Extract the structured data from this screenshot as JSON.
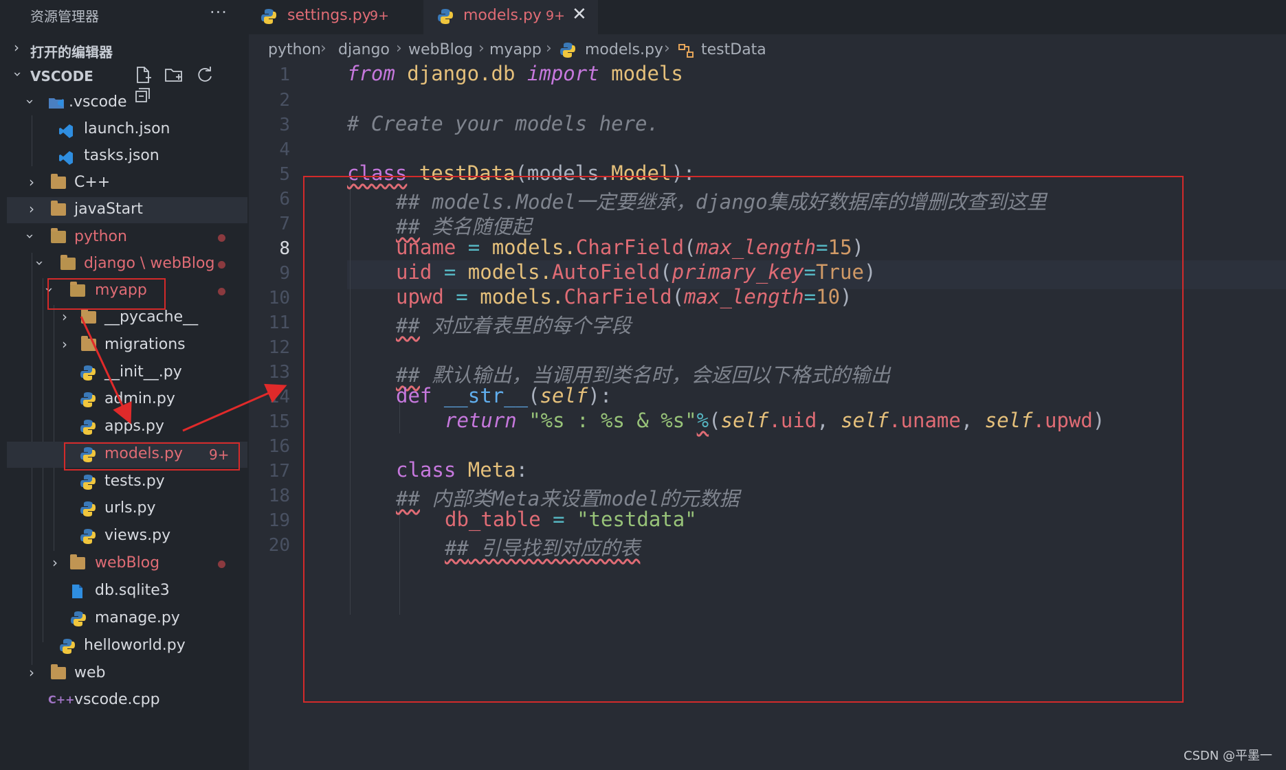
{
  "sidebar": {
    "explorer_title": "资源管理器",
    "more_label": "···",
    "open_editors_label": "打开的编辑器",
    "workspace_label": "VSCODE",
    "tree": {
      "vscode_folder": ".vscode",
      "launch": "launch.json",
      "tasks": "tasks.json",
      "cpp": "C++",
      "javastart": "javaStart",
      "python": "python",
      "django_webblog": "django \\ webBlog",
      "myapp": "myapp",
      "pycache": "__pycache__",
      "migrations": "migrations",
      "init": "__init__.py",
      "admin": "admin.py",
      "apps": "apps.py",
      "models": "models.py",
      "models_badge": "9+",
      "tests": "tests.py",
      "urls": "urls.py",
      "views": "views.py",
      "webblog": "webBlog",
      "db": "db.sqlite3",
      "manage": "manage.py",
      "helloworld": "helloworld.py",
      "web": "web",
      "vscode_cpp": "vscode.cpp"
    }
  },
  "tabs": [
    {
      "label": "settings.py",
      "badge": "9+"
    },
    {
      "label": "models.py",
      "badge": "9+",
      "close": "✕"
    }
  ],
  "breadcrumb": [
    "python",
    "django",
    "webBlog",
    "myapp",
    "models.py",
    "testData"
  ],
  "editor": {
    "line_numbers": [
      "1",
      "2",
      "3",
      "4",
      "5",
      "6",
      "7",
      "8",
      "9",
      "10",
      "11",
      "12",
      "13",
      "14",
      "15",
      "16",
      "17",
      "18",
      "19",
      "20"
    ],
    "current_line": "8",
    "code": {
      "l1": {
        "from": "from",
        "mod": " django.db ",
        "import": "import",
        "name": " models"
      },
      "l3": "# Create your models here.",
      "l5": {
        "class": "class",
        "name": " testData",
        "p1": "(models.",
        "base": "Model",
        "p2": "):"
      },
      "l6": "## models.Model一定要继承，django集成好数据库的增删改查到这里",
      "l7_hash": "##",
      "l7_text": " 类名随便起",
      "l8": {
        "var": "uname",
        "eq": " = ",
        "obj": "models.",
        "cls": "CharField",
        "po": "(",
        "kw": "max_length",
        "as": "=",
        "num": "15",
        "pc": ")"
      },
      "l9": {
        "var": "uid",
        "eq": " = ",
        "obj": "models.",
        "cls": "AutoField",
        "po": "(",
        "kw": "primary_key",
        "as": "=",
        "val": "True",
        "pc": ")"
      },
      "l10": {
        "var": "upwd",
        "eq": " = ",
        "obj": "models.",
        "cls": "CharField",
        "po": "(",
        "kw": "max_length",
        "as": "=",
        "num": "10",
        "pc": ")"
      },
      "l11_hash": "##",
      "l11_text": " 对应着表里的每个字段",
      "l13_hash": "##",
      "l13_text": " 默认输出，当调用到类名时，会返回以下格式的输出",
      "l14": {
        "def": "def",
        "fn": " __str__",
        "po": "(",
        "self": "self",
        "pc": "):"
      },
      "l15": {
        "ret": "return",
        "str": " \"%s : %s & %s\"",
        "pct": "%",
        "po": "(",
        "s1": "self",
        "a1": ".uid",
        "c1": ", ",
        "s2": "self",
        "a2": ".uname",
        "c2": ", ",
        "s3": "self",
        "a3": ".upwd",
        "pc": ")"
      },
      "l17": {
        "class": "class",
        "name": " Meta",
        "colon": ":"
      },
      "l18_hash": "##",
      "l18_text": " 内部类Meta来设置model的元数据",
      "l19": {
        "var": "db_table",
        "eq": " = ",
        "str": "\"testdata\""
      },
      "l20_hash": "##",
      "l20_text": " 引导找到对应的表"
    }
  },
  "watermark": "CSDN @平墨一",
  "colors": {
    "accent_red": "#e06c75",
    "annotation_red": "#d42a2a",
    "editor_bg": "#282c34",
    "sidebar_bg": "#21252b"
  }
}
